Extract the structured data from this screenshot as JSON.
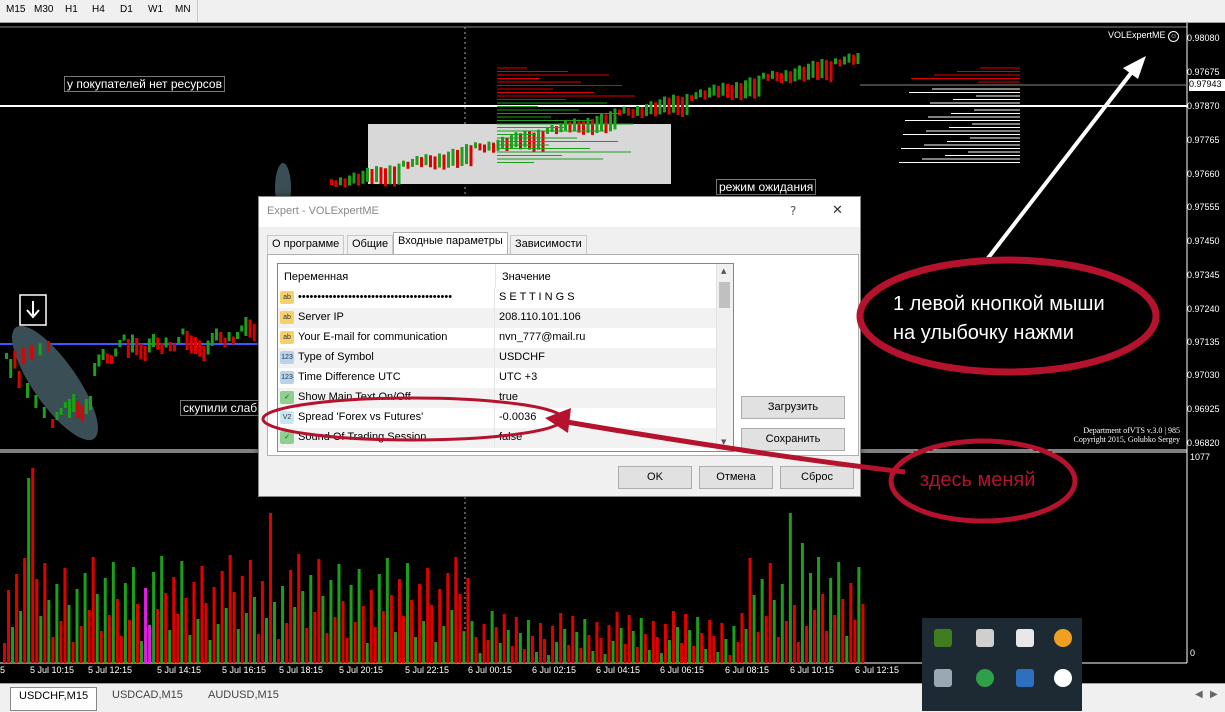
{
  "timeframes": [
    "M15",
    "M30",
    "H1",
    "H4",
    "D1",
    "W1",
    "MN"
  ],
  "price_axis": [
    "0.98080",
    "0.97675",
    "0.97943",
    "0.97870",
    "0.97765",
    "0.97660",
    "0.97555",
    "0.97450",
    "0.97345",
    "0.97240",
    "0.97135",
    "0.97030",
    "0.96925",
    "0.96820"
  ],
  "current_price": "0.97943",
  "volume_axis": {
    "top": "1077",
    "bottom": "0"
  },
  "time_axis": [
    "5",
    "5 Jul 10:15",
    "5 Jul 12:15",
    "5 Jul 14:15",
    "5 Jul 16:15",
    "5 Jul 18:15",
    "5 Jul 20:15",
    "5 Jul 22:15",
    "6 Jul 00:15",
    "6 Jul 02:15",
    "6 Jul 04:15",
    "6 Jul 06:15",
    "6 Jul 08:15",
    "6 Jul 10:15",
    "6 Jul 12:15"
  ],
  "chart_notes": {
    "buyers": "у покупателей нет ресурсов",
    "bought": "скупили слаб",
    "waiting": "режим ожидания"
  },
  "expert_label": "VOLExpertME",
  "copyright": {
    "line1": "Department ofVTS  v.3.0 | 985",
    "line2": "Copyright 2015, Golubko Sergey"
  },
  "chart_tabs": [
    "USDCHF,M15",
    "USDCAD,M15",
    "AUDUSD,M15"
  ],
  "dialog": {
    "title": "Expert - VOLExpertME",
    "help": "?",
    "close": "✕",
    "tabs": [
      "О программе",
      "Общие",
      "Входные параметры",
      "Зависимости"
    ],
    "columns": {
      "variable": "Переменная",
      "value": "Значение"
    },
    "rows": [
      {
        "icon": "ab",
        "name": "••••••••••••••••••••••••••••••••••••••••",
        "value": "S E T T I N G S"
      },
      {
        "icon": "ab",
        "name": "Server IP",
        "value": "208.110.101.106"
      },
      {
        "icon": "ab",
        "name": "Your E-mail for communication",
        "value": "nvn_777@mail.ru"
      },
      {
        "icon": "123",
        "name": "Type of Symbol",
        "value": "USDCHF"
      },
      {
        "icon": "123",
        "name": "Time Difference UTC",
        "value": "UTC +3"
      },
      {
        "icon": "bool",
        "name": "Show Main Text On/Off",
        "value": "true"
      },
      {
        "icon": "v2",
        "name": "Spread 'Forex vs Futures'",
        "value": "-0.0036"
      },
      {
        "icon": "bool",
        "name": "Sound Of Trading Session",
        "value": "false"
      }
    ],
    "buttons": {
      "load": "Загрузить",
      "save": "Сохранить",
      "ok": "OK",
      "cancel": "Отмена",
      "reset": "Сброс"
    }
  },
  "annotations": {
    "smile_hint_line1": "1 левой кнопкой мыши",
    "smile_hint_line2": "на улыбочку нажми",
    "change_here": "здесь меняй"
  },
  "colors": {
    "bull": "#1aa01a",
    "bear": "#e00000",
    "annotation": "#b5122e",
    "level_line": "#3a5aff"
  }
}
